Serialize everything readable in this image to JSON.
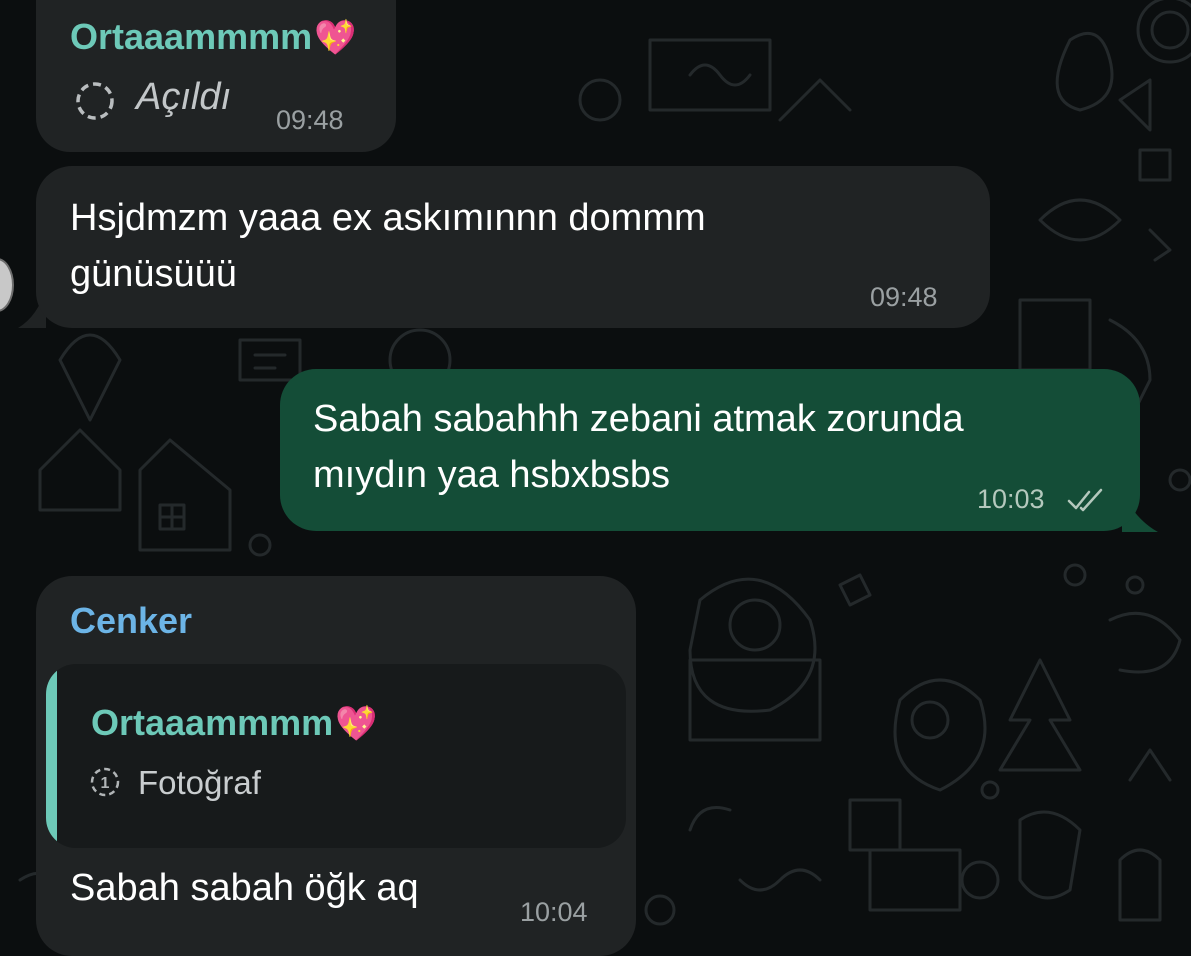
{
  "messages": [
    {
      "sender": "Ortaaammmm",
      "sender_emoji": "💖",
      "view_once_status": "Açıldı",
      "time": "09:48"
    },
    {
      "text": "Hsjdmzm yaaa ex askımınnn dommm\ngünüsüüü",
      "time": "09:48"
    },
    {
      "text": "Sabah sabahhh zebani atmak zorunda\nmıydın yaa hsbxbsbs",
      "time": "10:03",
      "status": "read"
    },
    {
      "sender": "Cenker",
      "quote": {
        "sender": "Ortaaammmm",
        "sender_emoji": "💖",
        "label": "Fotoğraf"
      },
      "text": "Sabah sabah öğk aq",
      "time": "10:04"
    }
  ],
  "colors": {
    "sender_ortaaammmm": "#6dc9b8",
    "sender_cenker": "#6cb4e6",
    "incoming_bubble": "#202324",
    "outgoing_bubble": "#144d37"
  }
}
